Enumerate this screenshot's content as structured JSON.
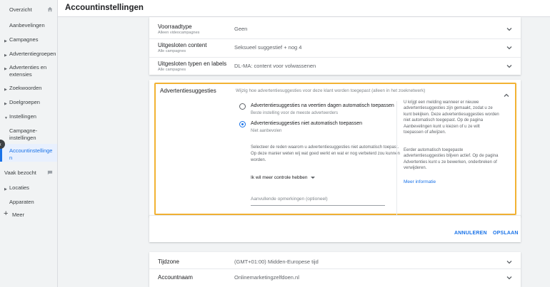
{
  "header": {
    "title": "Accountinstellingen"
  },
  "sidebar": {
    "items": [
      {
        "label": "Overzicht"
      },
      {
        "label": "Aanbevelingen"
      },
      {
        "label": "Campagnes"
      },
      {
        "label": "Advertentiegroepen"
      },
      {
        "label": "Advertenties en extensies"
      },
      {
        "label": "Zoekwoorden"
      },
      {
        "label": "Doelgroepen"
      },
      {
        "label": "Instellingen"
      },
      {
        "label": "Campagne-instellingen"
      },
      {
        "label": "Accountinstellingen"
      },
      {
        "label": "Vaak bezocht"
      },
      {
        "label": "Locaties"
      },
      {
        "label": "Apparaten"
      },
      {
        "label": "Meer"
      }
    ]
  },
  "top_rows": [
    {
      "label": "Voorraadtype",
      "sub": "Alleen videocampagnes",
      "value": "Geen"
    },
    {
      "label": "Uitgesloten content",
      "sub": "Alle campagnes",
      "value": "Seksueel suggestief + nog 4"
    },
    {
      "label": "Uitgesloten typen en labels",
      "sub": "Alle campagnes",
      "value": "DL-MA: content voor volwassenen"
    }
  ],
  "expanded": {
    "title": "Advertentiesuggesties",
    "desc": "Wijzig hoe advertentiesuggesties voor deze klant worden toegepast (alleen in het zoeknetwerk)",
    "option1": {
      "label": "Advertentiesuggesties na veertien dagen automatisch toepassen",
      "sub": "Beste instelling voor de meeste adverteerders"
    },
    "option2": {
      "label": "Advertentiesuggesties niet automatisch toepassen",
      "sub": "Niet aanbevolen"
    },
    "help": "Selecteer de reden waarom u advertentiesuggesties niet automatisch toepast. Op deze manier weten wij wat goed werkt en wat er nog verbeterd zou kunnen worden.",
    "dropdown": "Ik wil meer controle hebben",
    "comment_placeholder": "Aanvullende opmerkingen (optioneel)",
    "side_text1": "U krijgt een melding wanneer er nieuwe advertentiesuggesties zijn gemaakt, zodat u ze kunt bekijken. Deze advertentiesuggesties worden niet automatisch toegepast. Op de pagina Aanbevelingen kunt u kiezen of u ze wilt toepassen of afwijzen.",
    "side_text2": "Eerder automatisch toegepaste advertentiesuggesties blijven actief. Op de pagina Advertenties kunt u ze bewerken, onderbreken of verwijderen.",
    "more_link": "Meer informatie"
  },
  "actions": {
    "cancel": "ANNULEREN",
    "save": "OPSLAAN"
  },
  "bottom_rows": [
    {
      "label": "Tijdzone",
      "value": "(GMT+01:00) Midden-Europese tijd"
    },
    {
      "label": "Accountnaam",
      "value": "Onlinemarketingzelfdoen.nl"
    }
  ],
  "colors": {
    "accent": "#1a73e8",
    "highlight_border": "#f2b233"
  }
}
